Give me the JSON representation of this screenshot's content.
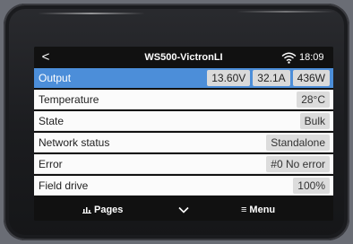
{
  "header": {
    "back_glyph": "<",
    "title": "WS500-VictronLI",
    "wifi_icon": "wifi-icon",
    "time": "18:09"
  },
  "rows": [
    {
      "label": "Output",
      "values": [
        "13.60V",
        "32.1A",
        "436W"
      ],
      "selected": true
    },
    {
      "label": "Temperature",
      "values": [
        "28°C"
      ]
    },
    {
      "label": "State",
      "values": [
        "Bulk"
      ]
    },
    {
      "label": "Network status",
      "values": [
        "Standalone"
      ]
    },
    {
      "label": "Error",
      "values": [
        "#0 No error"
      ]
    },
    {
      "label": "Field drive",
      "values": [
        "100%"
      ]
    }
  ],
  "footer": {
    "pages_label": "Pages",
    "pages_icon": "bar-chart-icon",
    "chevron_icon": "chevron-down-icon",
    "menu_glyph": "≡",
    "menu_label": "Menu"
  },
  "colors": {
    "selected_row": "#4c8ed9",
    "row_bg": "#fbfbfb",
    "bar_bg": "#111111",
    "value_pill": "#dcdcdc"
  }
}
